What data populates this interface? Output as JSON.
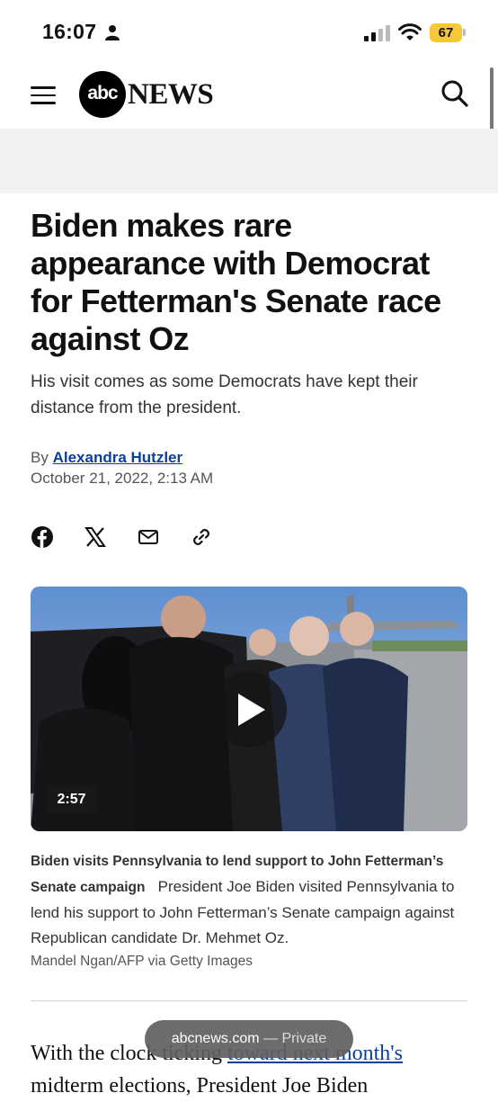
{
  "status_bar": {
    "time": "16:07",
    "battery": "67"
  },
  "header": {
    "logo_circle": "abc",
    "logo_text": "NEWS"
  },
  "article": {
    "headline": "Biden makes rare appearance with Democrat for Fetterman's Senate race against Oz",
    "dek": "His visit comes as some Democrats have kept their distance from the president.",
    "byline_prefix": "By",
    "author": "Alexandra Hutzler",
    "date": "October 21, 2022, 2:13 AM"
  },
  "share": {
    "icons": [
      "facebook-icon",
      "x-icon",
      "email-icon",
      "link-icon"
    ]
  },
  "video": {
    "duration": "2:57"
  },
  "caption": {
    "title": "Biden visits Pennsylvania to lend support to John Fetterman’s Senate campaign",
    "text": "President Joe Biden visited Pennsylvania to lend his support to John Fetterman’s Senate campaign against Republican candidate Dr. Mehmet Oz.",
    "credit": "Mandel Ngan/AFP via Getty Images"
  },
  "body": {
    "line1_start": "With the clock ticking ",
    "line1_link": "toward next month's",
    "line2": "midterm elections, President Joe Biden"
  },
  "url_pill": {
    "domain": "abcnews.com",
    "sep": " — ",
    "mode": "Private"
  },
  "colors": {
    "link": "#0a3f9c",
    "battery": "#f5c935",
    "ad_band": "#f2f2f2"
  }
}
